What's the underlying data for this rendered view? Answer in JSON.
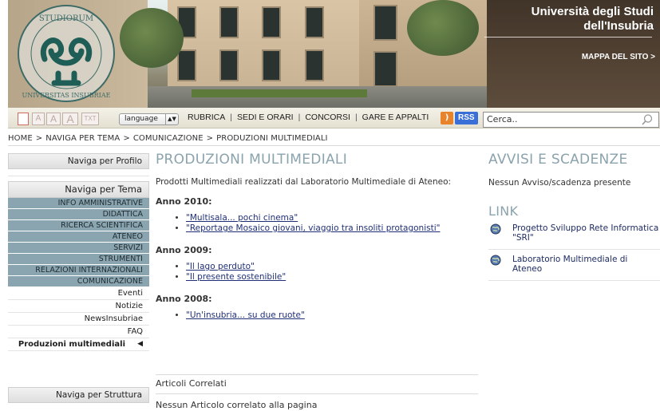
{
  "header": {
    "university_line1": "Università degli Studi",
    "university_line2": "dell'Insubria",
    "site_map": "MAPPA DEL SITO >",
    "seal_text_top": "STUDIORUM",
    "seal_text_bottom": "UNIVERSITAS INSUBRIAE"
  },
  "toolbar": {
    "font_sizes": [
      "A",
      "A",
      "A",
      "TXT"
    ],
    "language": "language",
    "links": [
      "RUBRICA",
      "SEDI E ORARI",
      "CONCORSI",
      "GARE E APPALTI"
    ],
    "rss_label": "RSS",
    "search_value": "Cerca.."
  },
  "breadcrumb": [
    "HOME",
    "NAVIGA PER TEMA",
    "COMUNICAZIONE",
    "PRODUZIONI MULTIMEDIALI"
  ],
  "sidebar": {
    "profile": "Naviga per Profilo",
    "theme": "Naviga per Tema",
    "categories": [
      "INFO AMMINISTRATIVE",
      "DIDATTICA",
      "RICERCA SCIENTIFICA",
      "ATENEO",
      "SERVIZI",
      "STRUMENTI",
      "RELAZIONI INTERNAZIONALI",
      "COMUNICAZIONE"
    ],
    "subitems": [
      "Eventi",
      "Notizie",
      "NewsInsubriae",
      "FAQ",
      "Produzioni multimediali"
    ],
    "structure": "Naviga per Struttura"
  },
  "main": {
    "title": "PRODUZIONI MULTIMEDIALI",
    "intro": "Prodotti Multimediali realizzati dal Laboratorio Multimediale di Ateneo:",
    "years": [
      {
        "label": "Anno 2010:",
        "items": [
          "\"Multisala... pochi cinema\"",
          "\"Reportage Mosaico giovani, viaggio tra insoliti protagonisti\""
        ]
      },
      {
        "label": "Anno 2009:",
        "items": [
          "\"Il lago perduto\"",
          "\"Il presente sostenibile\""
        ]
      },
      {
        "label": "Anno 2008:",
        "items": [
          "\"Un'insubria... su due ruote\""
        ]
      }
    ],
    "related_title": "Articoli Correlati",
    "related_empty": "Nessun Articolo correlato alla pagina"
  },
  "right": {
    "notices_title": "AVVISI E SCADENZE",
    "notices_empty": "Nessun Avviso/scadenza presente",
    "links_title": "LINK",
    "links": [
      {
        "line1": "Progetto Sviluppo Rete Informatica",
        "line2": "\"SRI\""
      },
      {
        "line1": "Laboratorio Multimediale di",
        "line2": "Ateneo"
      }
    ]
  },
  "colors": {
    "accent_title": "#8aa3ad",
    "nav_category_bg": "#8aa5b0",
    "link": "#1f2f77"
  }
}
